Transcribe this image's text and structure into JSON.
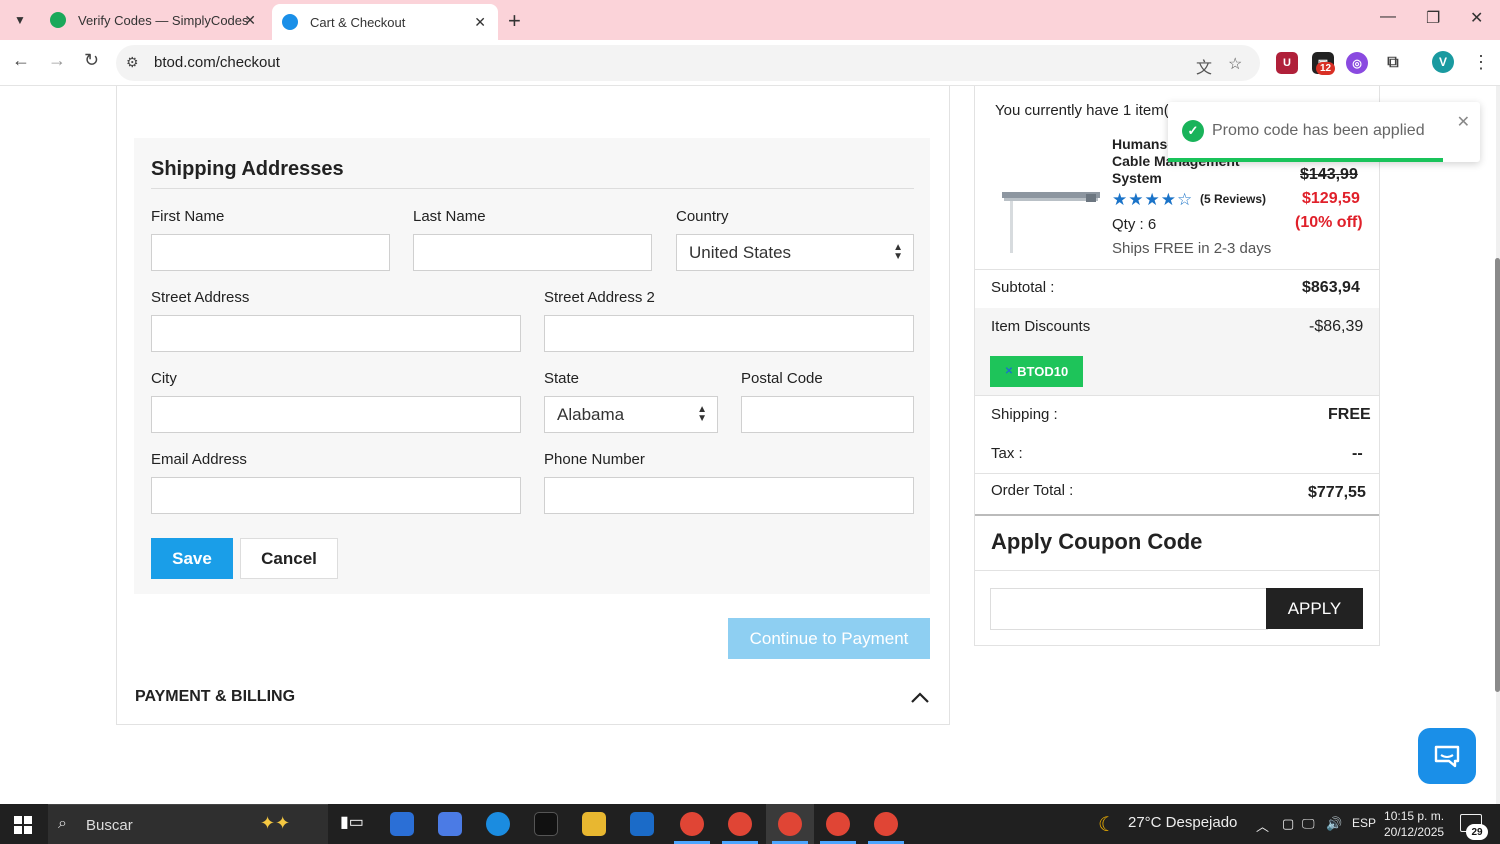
{
  "browser": {
    "tabs": [
      {
        "title": "Verify Codes — SimplyCodes",
        "active": false,
        "favicon_color": "#1aa85a"
      },
      {
        "title": "Cart & Checkout",
        "active": true,
        "favicon_color": "#1a8fe8"
      }
    ],
    "url": "btod.com/checkout",
    "extension_badge": "12",
    "profile_initial": "V"
  },
  "shipping": {
    "title": "Shipping Addresses",
    "first_name_label": "First Name",
    "last_name_label": "Last Name",
    "country_label": "Country",
    "country_value": "United States",
    "street_label": "Street Address",
    "street2_label": "Street Address 2",
    "city_label": "City",
    "state_label": "State",
    "state_value": "Alabama",
    "postal_label": "Postal Code",
    "email_label": "Email Address",
    "phone_label": "Phone Number",
    "save_label": "Save",
    "cancel_label": "Cancel"
  },
  "continue_label": "Continue to Payment",
  "payment_title": "PAYMENT & BILLING",
  "cart": {
    "items_text": "You currently have 1 item(s",
    "product_line1": "Humanscale",
    "product_line2": "Cable Management",
    "product_line3": "System",
    "stars_text": "★★★★☆",
    "rating": 4,
    "reviews": "(5 Reviews)",
    "qty": "Qty : 6",
    "ships": "Ships FREE in 2-3 days",
    "price_old": "$143,99",
    "price_new": "$129,59",
    "price_off": "(10% off)",
    "subtotal_label": "Subtotal :",
    "subtotal_value": "$863,94",
    "discounts_label": "Item Discounts",
    "discounts_value": "-$86,39",
    "coupon_code": "BTOD10",
    "shipping_label": "Shipping :",
    "shipping_value": "FREE",
    "tax_label": "Tax :",
    "tax_value": "--",
    "total_label": "Order Total :",
    "total_value": "$777,55"
  },
  "coupon": {
    "title": "Apply Coupon Code",
    "apply_label": "APPLY"
  },
  "toast": {
    "message": "Promo code has been applied",
    "progress": 0.88
  },
  "taskbar": {
    "search_text": "Buscar",
    "weather": "27°C  Despejado",
    "lang": "ESP",
    "time": "10:15 p. m.",
    "date": "20/12/2025",
    "notif_count": "29"
  },
  "colors": {
    "accent": "#1a9ee8",
    "coupon_green": "#1ec45a",
    "discount_red": "#e0202a",
    "tab_bar": "#fbd3d9"
  }
}
